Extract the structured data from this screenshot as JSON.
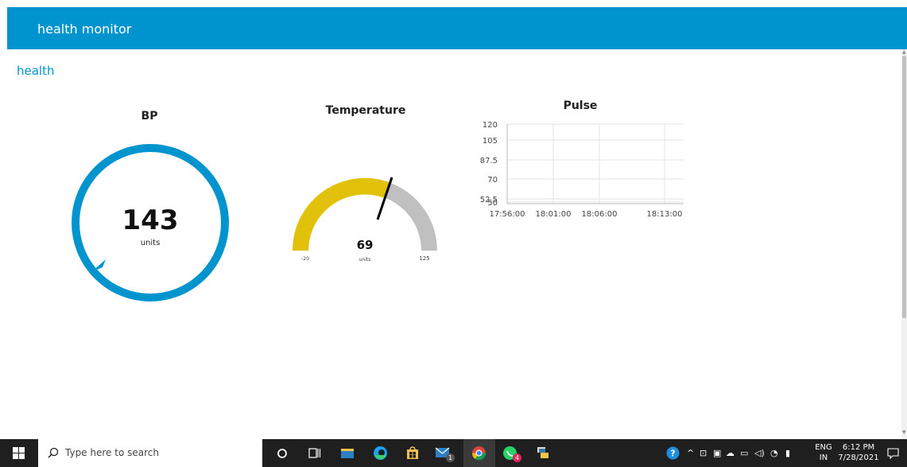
{
  "header": {
    "title": "health monitor"
  },
  "group": {
    "title": "health"
  },
  "bp": {
    "title": "BP",
    "value": "143",
    "unit": "units",
    "color": "#0094ce"
  },
  "temperature": {
    "title": "Temperature",
    "value": "69",
    "unit": "units",
    "min_label": "-20",
    "max_label": "125",
    "fill_color": "#e2c10a",
    "track_color": "#c0c0c0"
  },
  "pulse": {
    "title": "Pulse",
    "chart_data": {
      "type": "line",
      "title": "Pulse",
      "x_ticks": [
        "17:56:00",
        "18:01:00",
        "18:06:00",
        "18:13:00"
      ],
      "y_ticks": [
        "120",
        "105",
        "87.5",
        "70",
        "52.5",
        "50"
      ],
      "ylim": [
        50,
        120
      ],
      "grid": true,
      "series": []
    }
  },
  "taskbar": {
    "search_placeholder": "Type here to search",
    "language": "ENG",
    "region": "IN",
    "time": "6:12 PM",
    "date": "7/28/2021",
    "badge_one": "1",
    "badge_two": "4"
  }
}
